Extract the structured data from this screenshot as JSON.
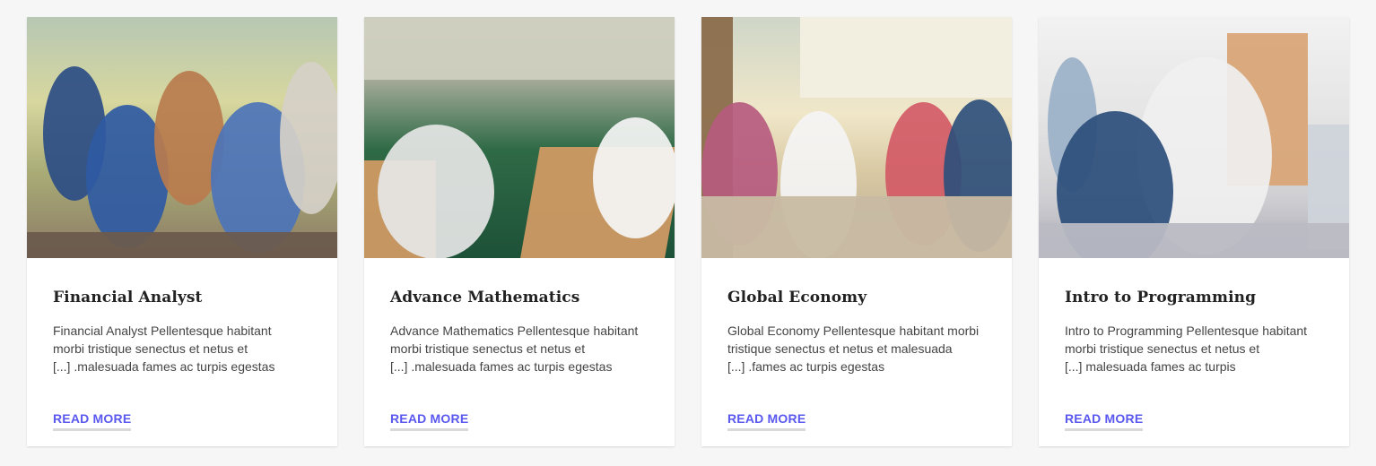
{
  "cards": [
    {
      "image_alt": "Students sitting together outdoors",
      "title": "Financial Analyst",
      "excerpt": "Financial Analyst Pellentesque habitant\nmorbi tristique senectus et netus et\n[...] .malesuada fames ac turpis egestas",
      "read_more": "READ MORE"
    },
    {
      "image_alt": "Students writing an exam at desks",
      "title": "Advance Mathematics",
      "excerpt": "Advance Mathematics Pellentesque habitant\nmorbi tristique senectus et netus et\n[...] .malesuada fames ac turpis egestas",
      "read_more": "READ MORE"
    },
    {
      "image_alt": "Students studying together outside",
      "title": "Global Economy",
      "excerpt": "Global Economy Pellentesque habitant morbi\ntristique senectus et netus et malesuada\n[...] .fames ac turpis egestas",
      "read_more": "READ MORE"
    },
    {
      "image_alt": "Teacher helping students in a computer class",
      "title": "Intro to Programming",
      "excerpt": "Intro to Programming Pellentesque habitant\nmorbi tristique senectus et netus et\n[...] malesuada fames ac turpis",
      "read_more": "READ MORE"
    }
  ],
  "colors": {
    "background": "#f6f6f6",
    "card": "#ffffff",
    "title": "#222222",
    "text": "#444444",
    "link": "#5a58ee",
    "link_underline": "#d9d9d9"
  }
}
